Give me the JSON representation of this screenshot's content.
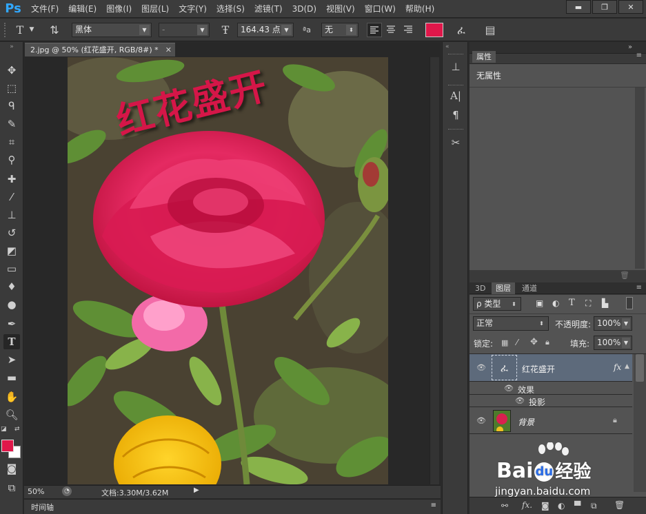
{
  "app": {
    "logo": "Ps"
  },
  "menu": [
    "文件(F)",
    "编辑(E)",
    "图像(I)",
    "图层(L)",
    "文字(Y)",
    "选择(S)",
    "滤镜(T)",
    "3D(D)",
    "视图(V)",
    "窗口(W)",
    "帮助(H)"
  ],
  "window_controls": {
    "minimize": "▬",
    "restore": "❐",
    "close": "✕"
  },
  "options": {
    "tool_icon": "T",
    "font_family": "黑体",
    "font_style": "-",
    "font_size": "164.43 点",
    "aa_label": "ªa",
    "aa_mode": "无",
    "text_color": "#e0174a"
  },
  "document": {
    "tab_title": "2.jpg @ 50% (红花盛开, RGB/8#) *",
    "canvas_text": "红花盛开",
    "canvas_text_color": "#d51648",
    "zoom": "50%",
    "doc_size": "文档:3.30M/3.62M"
  },
  "timeline": {
    "label": "时间轴"
  },
  "properties": {
    "tab": "属性",
    "content": "无属性"
  },
  "layers_panel": {
    "tabs": [
      "3D",
      "图层",
      "通道"
    ],
    "filter_kind": "ρ 类型",
    "blend_mode": "正常",
    "opacity_label": "不透明度:",
    "opacity_value": "100%",
    "lock_label": "锁定:",
    "fill_label": "填充:",
    "fill_value": "100%",
    "layers": [
      {
        "name": "红花盛开",
        "fx": "fx",
        "effects_label": "效果",
        "effect": "投影"
      },
      {
        "name": "背景"
      }
    ]
  },
  "watermark": {
    "brand": "Bai",
    "brand2": "du",
    "suffix": "经验",
    "url": "jingyan.baidu.com"
  }
}
